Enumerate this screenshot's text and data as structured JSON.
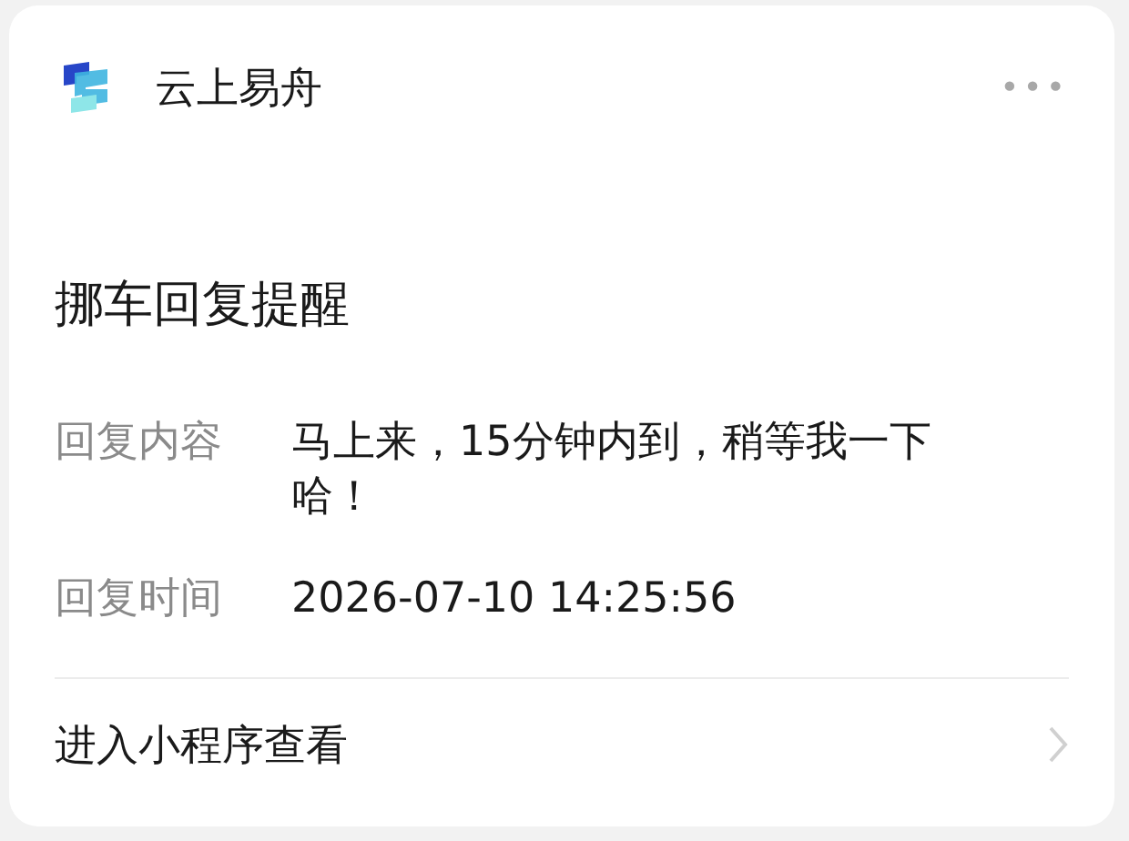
{
  "header": {
    "app_name": "云上易舟",
    "menu": "•••"
  },
  "title": "挪车回复提醒",
  "fields": [
    {
      "label": "回复内容",
      "value": "马上来，15分钟内到，稍等我一下哈！"
    },
    {
      "label": "回复时间",
      "value": "2026-07-10 14:25:56"
    }
  ],
  "footer": {
    "link": "进入小程序查看"
  }
}
